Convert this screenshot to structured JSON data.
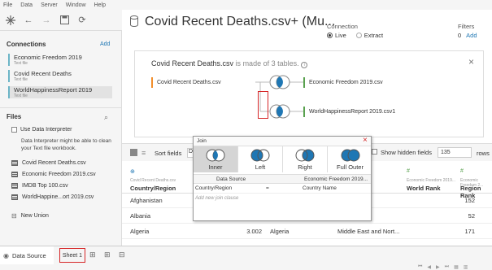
{
  "menu": [
    "File",
    "Data",
    "Server",
    "Window",
    "Help"
  ],
  "left": {
    "connections_title": "Connections",
    "add_label": "Add",
    "connections": [
      {
        "name": "Economic Freedom 2019",
        "type": "Text file"
      },
      {
        "name": "Covid Recent Deaths",
        "type": "Text file"
      },
      {
        "name": "WorldHappinessReport 2019",
        "type": "Text file"
      }
    ],
    "files_title": "Files",
    "use_interpreter": "Use Data Interpreter",
    "interpreter_help": "Data Interpreter might be able to clean your Text file workbook.",
    "files": [
      "Covid Recent Deaths.csv",
      "Economic Freedom 2019.csv",
      "IMDB Top 100.csv",
      "WorldHappine...ort 2019.csv"
    ],
    "new_union": "New Union"
  },
  "header": {
    "title": "Covid Recent Deaths.csv+ (Mu...",
    "connection_label": "Connection",
    "live": "Live",
    "extract": "Extract",
    "filters_label": "Filters",
    "filters_count": "0",
    "filters_add": "Add"
  },
  "canvas": {
    "made_of_prefix": "Covid Recent Deaths.csv",
    "made_of_suffix": "is made of 3 tables.",
    "info": "i",
    "close": "×",
    "left_table": "Covid Recent Deaths.csv",
    "right_table_1": "Economic Freedom 2019.csv",
    "right_table_2": "WorldHappinessReport 2019.csv1"
  },
  "gridbar": {
    "sort_label": "Sort fields",
    "sort_value": "D",
    "show_hidden": "Show hidden fields",
    "rows_value": "135",
    "rows_label": "rows"
  },
  "grid": {
    "columns": [
      {
        "src": "Covid Recent Deaths.csv",
        "name": "Country/Region"
      },
      {
        "src": "Economic Freedom 2019...",
        "name": "World Rank"
      },
      {
        "src": "Economic Freedom 2...",
        "name": "Region Rank"
      }
    ],
    "rows": [
      {
        "country": "Afghanistan",
        "num": "",
        "c2": "",
        "region": "",
        "rank": "152"
      },
      {
        "country": "Albania",
        "num": "",
        "c2": "",
        "region": "",
        "rank": "52"
      },
      {
        "country": "Algeria",
        "num": "3.002",
        "c2": "Algeria",
        "region": "Middle East and Nort...",
        "rank": "171"
      }
    ]
  },
  "join": {
    "title": "Join",
    "close": "×",
    "types": [
      "Inner",
      "Left",
      "Right",
      "Full Outer"
    ],
    "selected": "Inner",
    "col_left": "Data Source",
    "col_right": "Economic Freedom 2019...",
    "clause_left": "Country/Region",
    "clause_op": "=",
    "clause_right": "Country Name",
    "add_clause": "Add new join clause"
  },
  "tabs": {
    "data_source": "Data Source",
    "sheet1": "Sheet 1"
  },
  "colors": {
    "accent": "#1f77b4",
    "orange": "#f28e2b",
    "green": "#59a14f",
    "teal": "#6cb5c7",
    "highlight_red": "#d62728"
  }
}
